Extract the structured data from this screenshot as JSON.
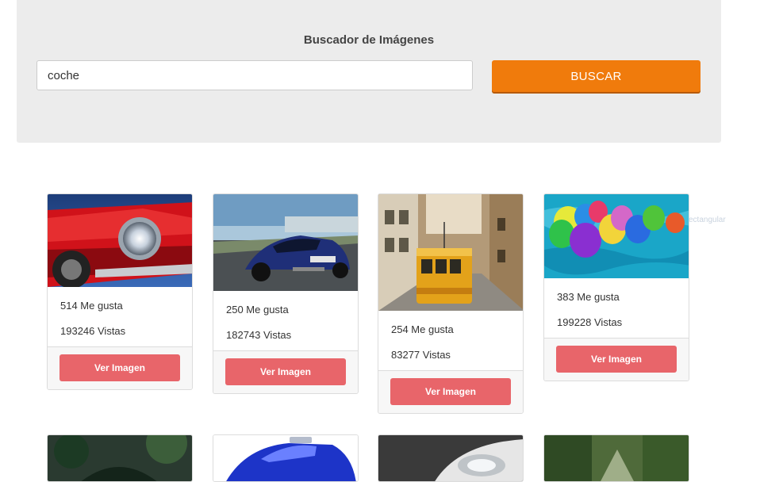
{
  "search": {
    "title": "Buscador de Imágenes",
    "input_value": "coche",
    "button_label": "BUSCAR"
  },
  "results": [
    {
      "likes": "514 Me gusta",
      "views": "193246 Vistas",
      "button": "Ver Imagen",
      "subject": "red-classic-car-headlight"
    },
    {
      "likes": "250 Me gusta",
      "views": "182743 Vistas",
      "button": "Ver Imagen",
      "subject": "blue-sports-car"
    },
    {
      "likes": "254 Me gusta",
      "views": "83277 Vistas",
      "button": "Ver Imagen",
      "subject": "yellow-tram-street"
    },
    {
      "likes": "383 Me gusta",
      "views": "199228 Vistas",
      "button": "Ver Imagen",
      "subject": "balloons-in-pool"
    }
  ],
  "second_row": [
    {
      "subject": "green-trees-aerial"
    },
    {
      "subject": "blue-roadster"
    },
    {
      "subject": "white-car-headlight"
    },
    {
      "subject": "forest-road"
    }
  ],
  "ghost_label": "ectangular",
  "colors": {
    "jumbotron_bg": "#ececec",
    "search_button": "#f07b0c",
    "card_button": "#e8656a"
  }
}
